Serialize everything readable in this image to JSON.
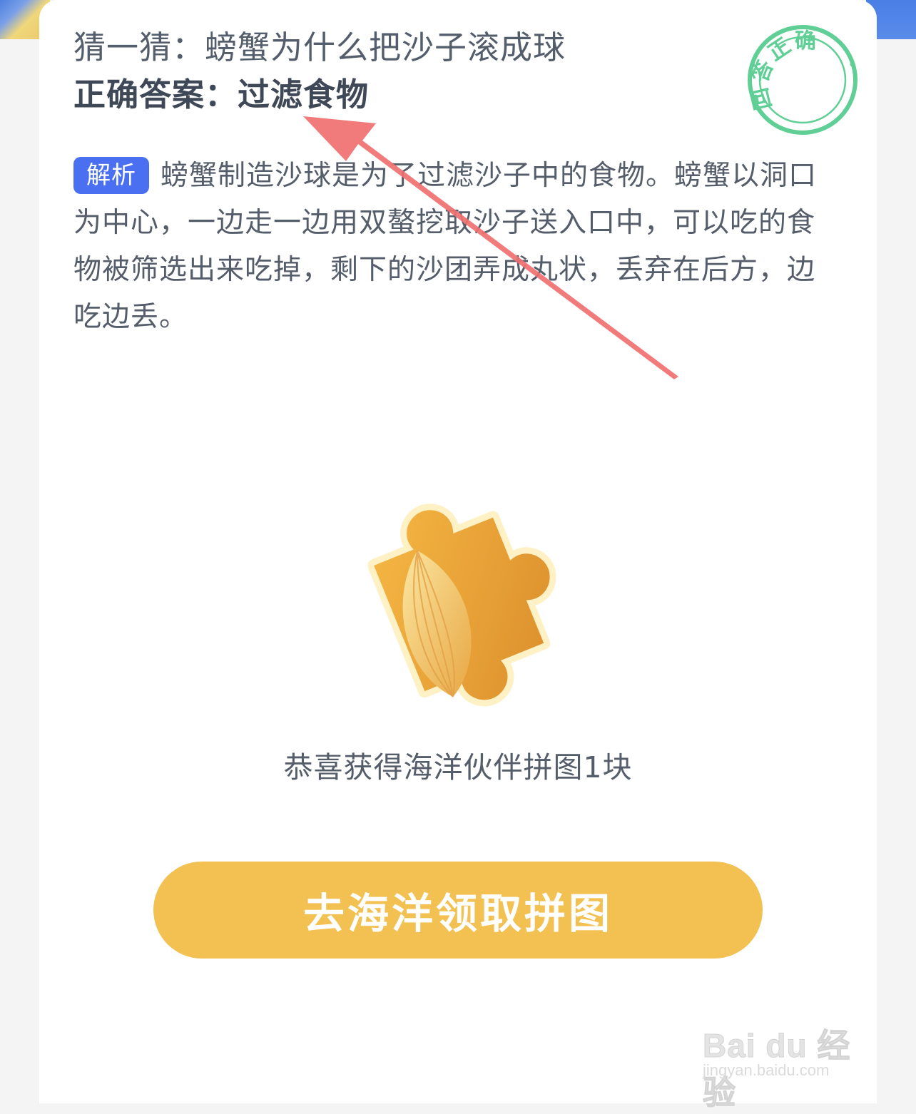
{
  "question": {
    "text": "猜一猜：螃蟹为什么把沙子滚成球"
  },
  "answer": {
    "text": "正确答案：过滤食物"
  },
  "stamp": {
    "text": "回答正确"
  },
  "explanation": {
    "tag": "解析",
    "text": "螃蟹制造沙球是为了过滤沙子中的食物。螃蟹以洞口为中心，一边走一边用双螯挖取沙子送入口中，可以吃的食物被筛选出来吃掉，剩下的沙团弄成丸状，丢弃在后方，边吃边丢。"
  },
  "reward": {
    "text": "恭喜获得海洋伙伴拼图1块"
  },
  "cta": {
    "label": "去海洋领取拼图"
  },
  "watermark": {
    "brand": "Bai du 经验",
    "url": "jingyan.baidu.com"
  },
  "colors": {
    "stamp_green": "#5fcf95",
    "tag_blue": "#4a6ff0",
    "cta_yellow": "#f2c152",
    "arrow_red": "#f07070"
  },
  "icons": [
    "puzzle-piece-icon",
    "correct-stamp-icon",
    "pointer-arrow"
  ]
}
